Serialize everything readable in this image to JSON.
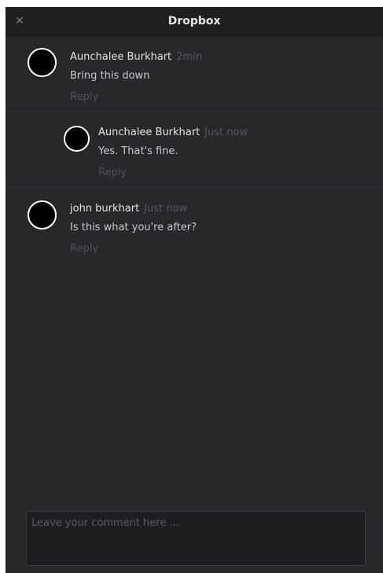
{
  "window": {
    "title": "Dropbox",
    "close_glyph": "×"
  },
  "comments": [
    {
      "author": "Aunchalee Burkhart",
      "time": "2min",
      "text": "Bring this down",
      "reply_label": "Reply",
      "nested": false
    },
    {
      "author": "Aunchalee Burkhart",
      "time": "Just now",
      "text": "Yes. That's fine.",
      "reply_label": "Reply",
      "nested": true
    },
    {
      "author": "john burkhart",
      "time": "Just now",
      "text": "Is this what you're after?",
      "reply_label": "Reply",
      "nested": false
    }
  ],
  "comment_input": {
    "value": "",
    "placeholder": "Leave your comment here ..."
  },
  "colors": {
    "background": "#28282b",
    "titlebar": "#1f1f22",
    "author": "#e4e4e6",
    "muted": "#56565c"
  },
  "icons": {
    "close": "close-icon",
    "avatar": "avatar"
  }
}
